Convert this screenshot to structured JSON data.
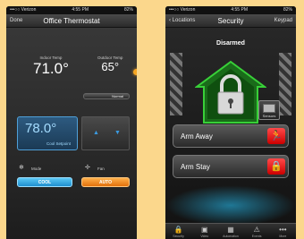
{
  "thermostat": {
    "status": {
      "carrier": "•••○○ Verizon",
      "time": "4:55 PM",
      "battery": "82%"
    },
    "nav": {
      "left": "Done",
      "title": "Office Thermostat"
    },
    "indoor": {
      "label": "Indoor Temp",
      "value": "71.0°"
    },
    "outdoor": {
      "label": "Outdoor Temp",
      "value": "65°"
    },
    "mode_pill": "Normal",
    "setpoint": {
      "value": "78.0°",
      "label": "Cool Setpoint"
    },
    "mode": {
      "label": "Mode",
      "button": "COOL"
    },
    "fan": {
      "label": "Fan",
      "button": "AUTO"
    }
  },
  "security": {
    "status": {
      "carrier": "•••○○ Verizon",
      "time": "4:55 PM",
      "battery": "82%"
    },
    "nav": {
      "left": "Locations",
      "title": "Security",
      "right": "Keypad"
    },
    "state": "Disarmed",
    "sensors_label": "Sensors",
    "arm_away": "Arm Away",
    "arm_stay": "Arm Stay",
    "tabs": [
      "Security",
      "Video",
      "Automation",
      "Events",
      "More"
    ]
  }
}
